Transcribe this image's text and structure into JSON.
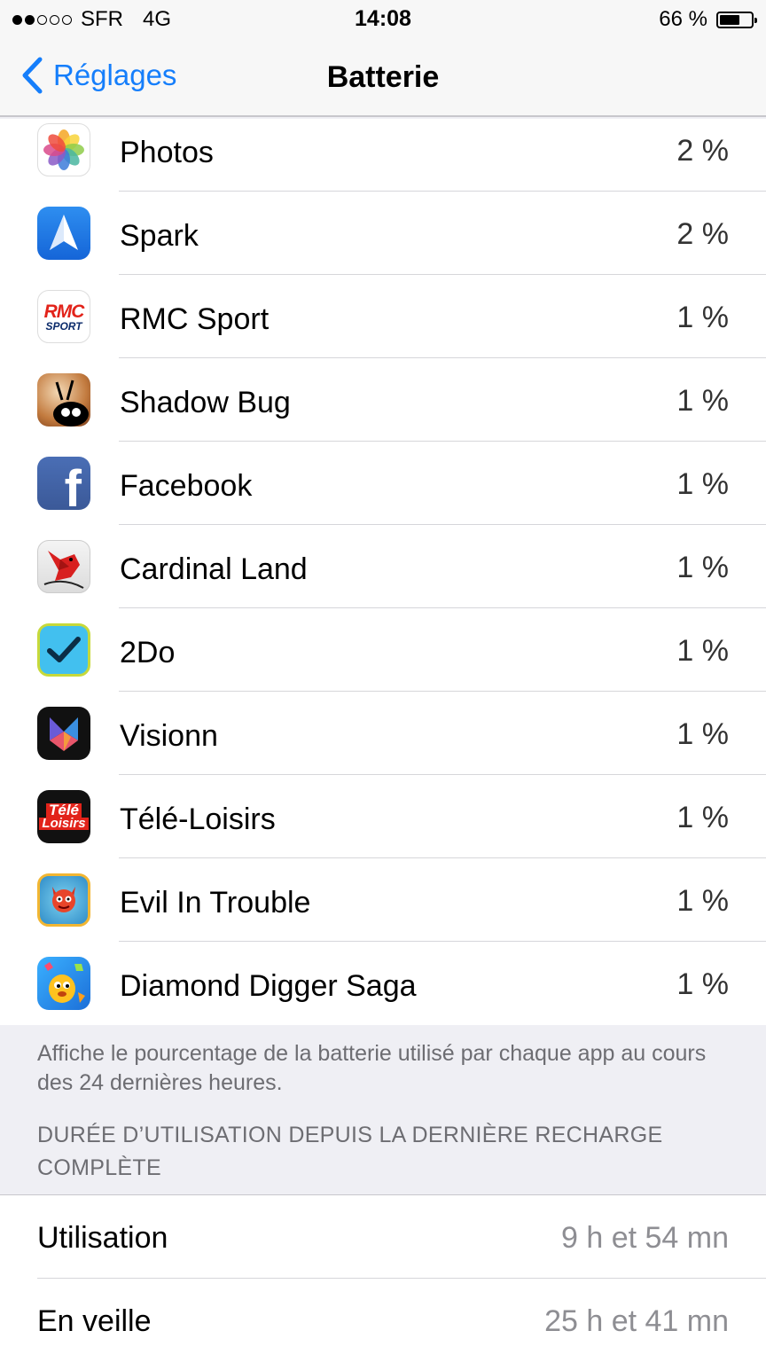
{
  "status_bar": {
    "carrier": "SFR",
    "network": "4G",
    "time": "14:08",
    "battery_text": "66 %",
    "battery_level": 0.66
  },
  "nav": {
    "back_label": "Réglages",
    "title": "Batterie"
  },
  "apps": [
    {
      "name": "Photos",
      "percent": "2 %",
      "icon": "photos-icon"
    },
    {
      "name": "Spark",
      "percent": "2 %",
      "icon": "spark-icon"
    },
    {
      "name": "RMC Sport",
      "percent": "1 %",
      "icon": "rmc-sport-icon",
      "icon_text_top": "RMC",
      "icon_text_bottom": "SPORT"
    },
    {
      "name": "Shadow Bug",
      "percent": "1 %",
      "icon": "shadow-bug-icon"
    },
    {
      "name": "Facebook",
      "percent": "1 %",
      "icon": "facebook-icon",
      "icon_glyph": "f"
    },
    {
      "name": "Cardinal Land",
      "percent": "1 %",
      "icon": "cardinal-land-icon"
    },
    {
      "name": "2Do",
      "percent": "1 %",
      "icon": "2do-icon"
    },
    {
      "name": "Visionn",
      "percent": "1 %",
      "icon": "visionn-icon"
    },
    {
      "name": "Télé-Loisirs",
      "percent": "1 %",
      "icon": "tele-loisirs-icon",
      "icon_text_top": "Télé",
      "icon_text_bottom": "Loisirs"
    },
    {
      "name": "Evil In Trouble",
      "percent": "1 %",
      "icon": "evil-in-trouble-icon"
    },
    {
      "name": "Diamond Digger Saga",
      "percent": "1 %",
      "icon": "diamond-digger-saga-icon"
    }
  ],
  "footer_note": "Affiche le pourcentage de la batterie utilisé par chaque app au cours des 24 dernières heures.",
  "usage_section": {
    "header": "DURÉE D’UTILISATION DEPUIS LA DERNIÈRE RECHARGE COMPLÈTE",
    "rows": [
      {
        "label": "Utilisation",
        "value": "9 h et 54 mn"
      },
      {
        "label": "En veille",
        "value": "25 h et 41 mn"
      }
    ]
  },
  "colors": {
    "accent": "#157efb",
    "grouped_background": "#efeff4",
    "secondary_text": "#6d6d72",
    "value_text": "#8e8e93"
  }
}
